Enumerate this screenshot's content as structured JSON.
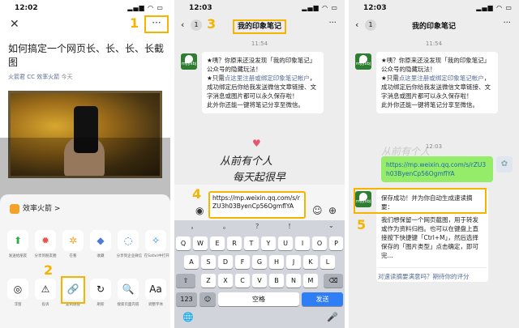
{
  "steps": [
    "1",
    "2",
    "3",
    "4",
    "5"
  ],
  "phone1": {
    "time": "12:02",
    "article_title": "如何搞定一个网页长、长、长、长截图",
    "author": "火箭君 CC 效率火箭",
    "date": "今天",
    "sheet_title": "效率火箭 >",
    "share_row": [
      "发送给朋友",
      "分享到朋友圈",
      "在看",
      "收藏",
      "分享到企业微信",
      "在Safari中打开"
    ],
    "tools_row": [
      "浮窗",
      "投诉",
      "复制链接",
      "刷新",
      "搜索页面内容",
      "调整字体"
    ],
    "tools_icons": [
      "◎",
      "⚠",
      "🔗",
      "↻",
      "🔍",
      "Aa"
    ]
  },
  "phone2": {
    "time": "12:03",
    "badge": "1",
    "chat_title": "我的印象笔记",
    "timestamp": "11:54",
    "msg1": "★咦？你原来还没发现「我的印象笔记」公众号的隐藏玩法！",
    "msg2_prefix": "★只需",
    "msg2_link": "点这里注册或绑定印象笔记帐户",
    "msg2_suffix": "，成功绑定后你给我发送微信文章链接、文字消息或图片都可以永久保存啦！",
    "msg3": "此外你还能一键将笔记分享至微信。",
    "handwriting_1": "从前有个人",
    "handwriting_2": "每天起很早",
    "heart": "♥",
    "input_text": "https://mp.weixin.qq.com/s/rZU3h03ByenCp56OgmflYA",
    "keyboard": {
      "suggestions": [
        "，",
        "。",
        "？",
        "！",
        "⌄"
      ],
      "row1": [
        "Q",
        "W",
        "E",
        "R",
        "T",
        "Y",
        "U",
        "I",
        "O",
        "P"
      ],
      "row2": [
        "A",
        "S",
        "D",
        "F",
        "G",
        "H",
        "J",
        "K",
        "L"
      ],
      "row3": [
        "Z",
        "X",
        "C",
        "V",
        "B",
        "N",
        "M"
      ],
      "num": "123",
      "emoji": "☺",
      "space": "空格",
      "send": "发送"
    }
  },
  "phone3": {
    "time": "12:03",
    "badge": "1",
    "chat_title": "我的印象笔记",
    "timestamp1": "11:54",
    "timestamp2": "12:03",
    "sent_link": "https://mp.weixin.qq.com/s/rZU3h03ByenCp56OgmflYA",
    "reply_title": "保存成功！并为你自动生成速读摘要：",
    "reply_body": "我们想保留一个网页截图，用于转发或作为资料归档。也可以在键盘上直接按下快捷键「Ctrl+M」，然后选择保存的「图片类型」点击确定，即可完...",
    "feedback": "对速读摘要满意吗？期待你的评分"
  },
  "colors": {
    "highlight": "#f5b400",
    "wechat_green": "#95ec69",
    "link": "#576b95",
    "send": "#2f7ef5"
  }
}
